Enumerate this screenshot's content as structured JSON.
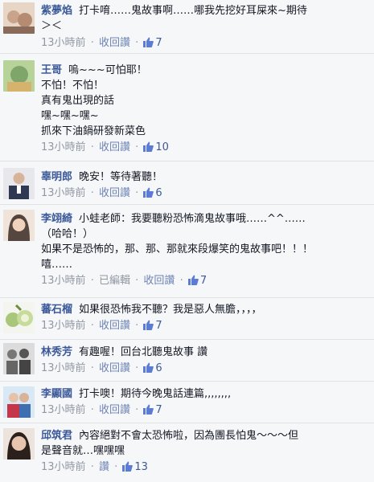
{
  "comments": [
    {
      "name": "紫夢焰",
      "text": "打卡唷……鬼故事啊……哪我先挖好耳屎來~期待\n＞＜",
      "time": "13小時前",
      "edited": "",
      "reply": "收回讚",
      "likes": "7",
      "avatar_color": "#c9a38a"
    },
    {
      "name": "王哥",
      "text": "嗚~~~可怕耶！\n不怕！不怕！\n真有鬼出現的話\n嘿~嘿~嘿~\n抓來下油鍋研發新菜色",
      "time": "13小時前",
      "edited": "",
      "reply": "收回讚",
      "likes": "10",
      "avatar_color": "#7fa56a"
    },
    {
      "name": "辜明郎",
      "text": "晚安！等待著聽！",
      "time": "13小時前",
      "edited": "",
      "reply": "收回讚",
      "likes": "6",
      "avatar_color": "#5c6c8a"
    },
    {
      "name": "李翊綺",
      "text": "小蛙老師：我要聽粉恐怖滴鬼故事哦……^^……\n（哈哈！）\n如果不是恐怖的，那、那、那就來段爆笑的鬼故事吧！！！\n嘻……",
      "time": "13小時前",
      "edited": "已編輯",
      "reply": "收回讚",
      "likes": "7",
      "avatar_color": "#d9b8a4"
    },
    {
      "name": "蕃石榴",
      "text": "如果很恐怖我不聽？我是惡人無膽，，，，",
      "time": "13小時前",
      "edited": "",
      "reply": "收回讚",
      "likes": "7",
      "avatar_color": "#a9c77b"
    },
    {
      "name": "林秀芳",
      "text": "有趣喔！回台北聽鬼故事 讚",
      "time": "13小時前",
      "edited": "",
      "reply": "收回讚",
      "likes": "6",
      "avatar_color": "#888888"
    },
    {
      "name": "李顯國",
      "text": "打卡噢！期待今晚鬼話連篇,,,,,,,,",
      "time": "13小時前",
      "edited": "",
      "reply": "收回讚",
      "likes": "7",
      "avatar_color": "#8fb5d9"
    },
    {
      "name": "邱筑君",
      "text": "內容絕對不會太恐怖啦，因為團長怕鬼～～～但\n是聲音就…嘿嘿嘿",
      "time": "13小時前",
      "edited": "",
      "reply": "讚",
      "likes": "13",
      "avatar_color": "#b89a86"
    }
  ]
}
